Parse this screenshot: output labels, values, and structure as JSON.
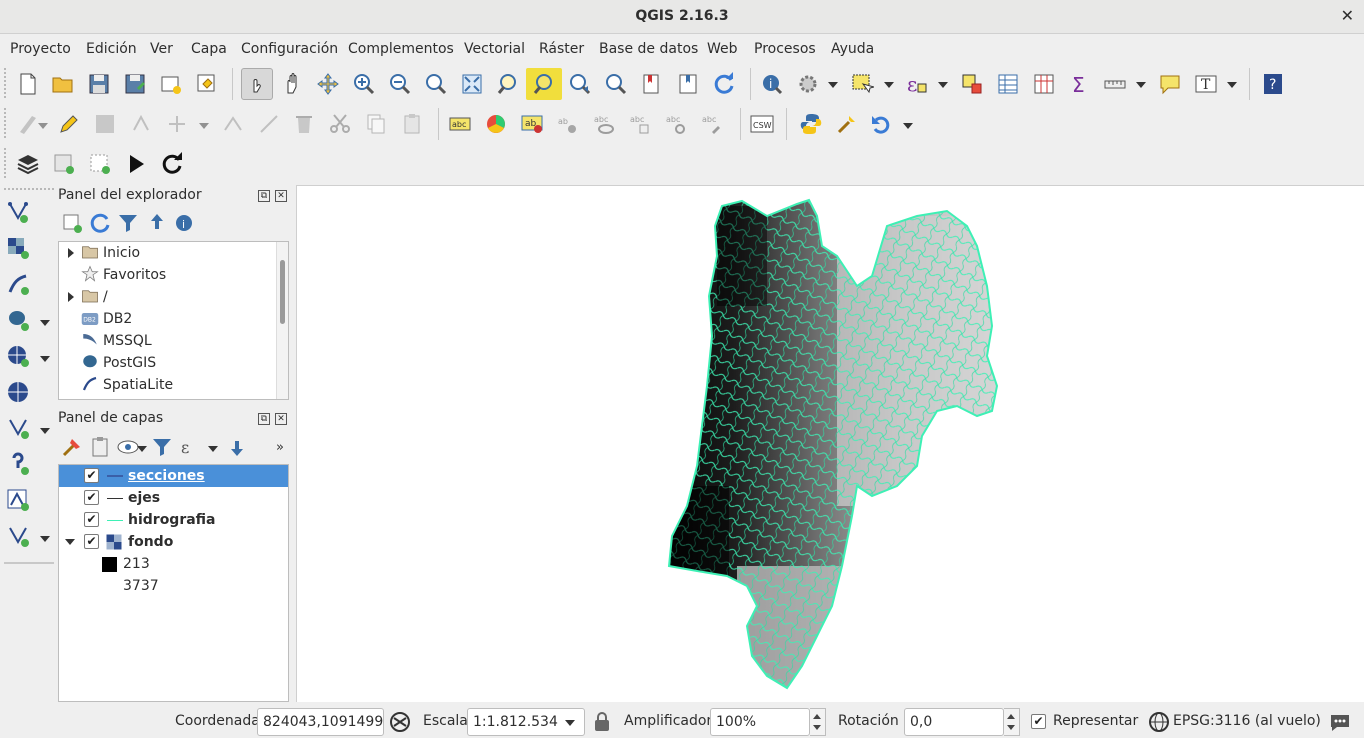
{
  "window": {
    "title": "QGIS 2.16.3",
    "close_glyph": "✕"
  },
  "menu": [
    "Proyecto",
    "Edición",
    "Ver",
    "Capa",
    "Configuración",
    "Complementos",
    "Vectorial",
    "Ráster",
    "Base de datos",
    "Web",
    "Procesos",
    "Ayuda"
  ],
  "browser_panel": {
    "title": "Panel del explorador",
    "items": [
      {
        "label": "Inicio",
        "icon": "folder-icon",
        "expandable": true
      },
      {
        "label": "Favoritos",
        "icon": "star-icon",
        "expandable": false
      },
      {
        "label": "/",
        "icon": "folder-icon",
        "expandable": true
      },
      {
        "label": "DB2",
        "icon": "db2-icon",
        "expandable": false
      },
      {
        "label": "MSSQL",
        "icon": "mssql-icon",
        "expandable": false
      },
      {
        "label": "PostGIS",
        "icon": "postgis-icon",
        "expandable": false
      },
      {
        "label": "SpatiaLite",
        "icon": "spatialite-icon",
        "expandable": false
      }
    ]
  },
  "layers_panel": {
    "title": "Panel de capas",
    "layers": [
      {
        "name": "secciones",
        "checked": true,
        "symbol": "line",
        "color": "#3a5fa8",
        "selected": true
      },
      {
        "name": "ejes",
        "checked": true,
        "symbol": "line",
        "color": "#333333",
        "selected": false
      },
      {
        "name": "hidrografia",
        "checked": true,
        "symbol": "line",
        "color": "#3ef0b5",
        "selected": false
      },
      {
        "name": "fondo",
        "checked": true,
        "symbol": "raster",
        "color": "#2b4a8c",
        "selected": false,
        "expanded": true
      }
    ],
    "legend": {
      "min_label": "213",
      "max_label": "3737"
    }
  },
  "statusbar": {
    "coord_label": "Coordenada",
    "coord_value": "824043,1091499",
    "scale_label": "Escala",
    "scale_value": "1:1.812.534",
    "magnifier_label": "Amplificador",
    "magnifier_value": "100%",
    "rotation_label": "Rotación",
    "rotation_value": "0,0",
    "render_label": "Representar",
    "render_checked": true,
    "crs_label": "EPSG:3116 (al vuelo)"
  },
  "colors": {
    "selection": "#4a90d9",
    "hydro": "#3ef0b5",
    "raster_low": "#000000"
  }
}
